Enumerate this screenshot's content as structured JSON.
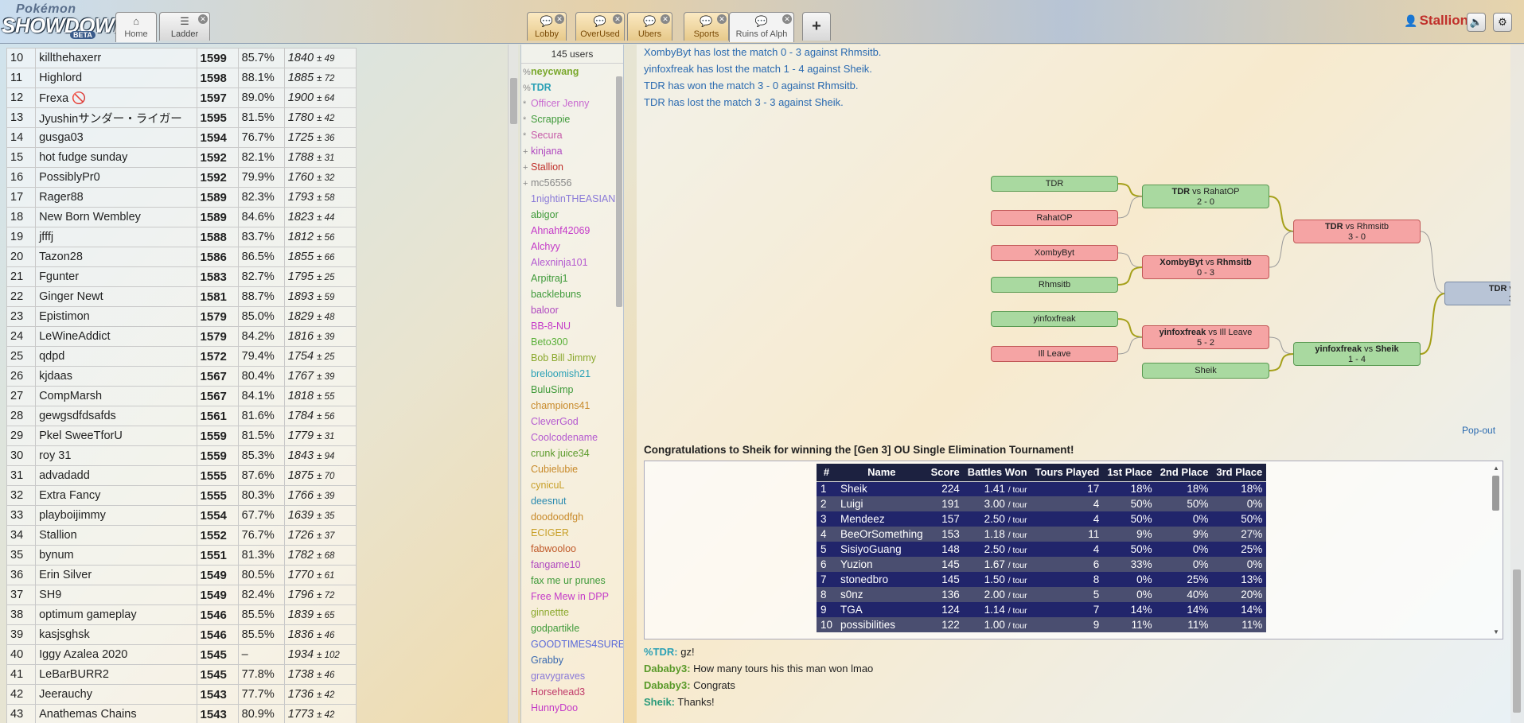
{
  "header": {
    "logo_top": "Pokémon",
    "logo_main": "SHOWDOWN!",
    "logo_badge": "BETA",
    "tabs_left": [
      {
        "label": "Home",
        "icon": "⌂",
        "closable": false
      },
      {
        "label": "Ladder",
        "icon": "☰",
        "closable": true
      }
    ],
    "tabs_rooms": [
      {
        "label": "Lobby",
        "icon": "💬"
      },
      {
        "label": "OverUsed",
        "icon": "💬"
      },
      {
        "label": "Ubers",
        "icon": "💬"
      },
      {
        "label": "Sports",
        "icon": "💬"
      },
      {
        "label": "Ruins of Alph",
        "icon": "💬"
      }
    ],
    "tab_plus": "+",
    "username": "Stallion",
    "user_icon": "👤",
    "sound_icon": "🔈",
    "settings_icon": "⚙"
  },
  "ladder": {
    "rows": [
      {
        "rank": "10",
        "name": "killthehaxerr",
        "elo": "1599",
        "gxe": "85.7%",
        "glicko": "1840",
        "dev": "± 49"
      },
      {
        "rank": "11",
        "name": "Highlord",
        "elo": "1598",
        "gxe": "88.1%",
        "glicko": "1885",
        "dev": "± 72"
      },
      {
        "rank": "12",
        "name": "Frexa 🚫",
        "elo": "1597",
        "gxe": "89.0%",
        "glicko": "1900",
        "dev": "± 64"
      },
      {
        "rank": "13",
        "name": "Jyushinサンダー・ライガー",
        "elo": "1595",
        "gxe": "81.5%",
        "glicko": "1780",
        "dev": "± 42"
      },
      {
        "rank": "14",
        "name": "gusga03",
        "elo": "1594",
        "gxe": "76.7%",
        "glicko": "1725",
        "dev": "± 36"
      },
      {
        "rank": "15",
        "name": "hot fudge sunday",
        "elo": "1592",
        "gxe": "82.1%",
        "glicko": "1788",
        "dev": "± 31"
      },
      {
        "rank": "16",
        "name": "PossiblyPr0",
        "elo": "1592",
        "gxe": "79.9%",
        "glicko": "1760",
        "dev": "± 32"
      },
      {
        "rank": "17",
        "name": "Rager88",
        "elo": "1589",
        "gxe": "82.3%",
        "glicko": "1793",
        "dev": "± 58"
      },
      {
        "rank": "18",
        "name": "New Born Wembley",
        "elo": "1589",
        "gxe": "84.6%",
        "glicko": "1823",
        "dev": "± 44"
      },
      {
        "rank": "19",
        "name": "jfffj",
        "elo": "1588",
        "gxe": "83.7%",
        "glicko": "1812",
        "dev": "± 56"
      },
      {
        "rank": "20",
        "name": "Tazon28",
        "elo": "1586",
        "gxe": "86.5%",
        "glicko": "1855",
        "dev": "± 66"
      },
      {
        "rank": "21",
        "name": "Fgunter",
        "elo": "1583",
        "gxe": "82.7%",
        "glicko": "1795",
        "dev": "± 25"
      },
      {
        "rank": "22",
        "name": "Ginger Newt",
        "elo": "1581",
        "gxe": "88.7%",
        "glicko": "1893",
        "dev": "± 59"
      },
      {
        "rank": "23",
        "name": "Epistimon",
        "elo": "1579",
        "gxe": "85.0%",
        "glicko": "1829",
        "dev": "± 48"
      },
      {
        "rank": "24",
        "name": "LeWineAddict",
        "elo": "1579",
        "gxe": "84.2%",
        "glicko": "1816",
        "dev": "± 39"
      },
      {
        "rank": "25",
        "name": "qdpd",
        "elo": "1572",
        "gxe": "79.4%",
        "glicko": "1754",
        "dev": "± 25"
      },
      {
        "rank": "26",
        "name": "kjdaas",
        "elo": "1567",
        "gxe": "80.4%",
        "glicko": "1767",
        "dev": "± 39"
      },
      {
        "rank": "27",
        "name": "CompMarsh",
        "elo": "1567",
        "gxe": "84.1%",
        "glicko": "1818",
        "dev": "± 55"
      },
      {
        "rank": "28",
        "name": "gewgsdfdsafds",
        "elo": "1561",
        "gxe": "81.6%",
        "glicko": "1784",
        "dev": "± 56"
      },
      {
        "rank": "29",
        "name": "Pkel SweeTforU",
        "elo": "1559",
        "gxe": "81.5%",
        "glicko": "1779",
        "dev": "± 31"
      },
      {
        "rank": "30",
        "name": "roy 31",
        "elo": "1559",
        "gxe": "85.3%",
        "glicko": "1843",
        "dev": "± 94"
      },
      {
        "rank": "31",
        "name": "advadadd",
        "elo": "1555",
        "gxe": "87.6%",
        "glicko": "1875",
        "dev": "± 70"
      },
      {
        "rank": "32",
        "name": "Extra Fancy",
        "elo": "1555",
        "gxe": "80.3%",
        "glicko": "1766",
        "dev": "± 39"
      },
      {
        "rank": "33",
        "name": "playboijimmy",
        "elo": "1554",
        "gxe": "67.7%",
        "glicko": "1639",
        "dev": "± 35"
      },
      {
        "rank": "34",
        "name": "Stallion",
        "elo": "1552",
        "gxe": "76.7%",
        "glicko": "1726",
        "dev": "± 37"
      },
      {
        "rank": "35",
        "name": "bynum",
        "elo": "1551",
        "gxe": "81.3%",
        "glicko": "1782",
        "dev": "± 68"
      },
      {
        "rank": "36",
        "name": "Erin Silver",
        "elo": "1549",
        "gxe": "80.5%",
        "glicko": "1770",
        "dev": "± 61"
      },
      {
        "rank": "37",
        "name": "SH9",
        "elo": "1549",
        "gxe": "82.4%",
        "glicko": "1796",
        "dev": "± 72"
      },
      {
        "rank": "38",
        "name": "optimum gameplay",
        "elo": "1546",
        "gxe": "85.5%",
        "glicko": "1839",
        "dev": "± 65"
      },
      {
        "rank": "39",
        "name": "kasjsghsk",
        "elo": "1546",
        "gxe": "85.5%",
        "glicko": "1836",
        "dev": "± 46"
      },
      {
        "rank": "40",
        "name": "Iggy Azalea 2020",
        "elo": "1545",
        "gxe": "–",
        "glicko": "1934",
        "dev": "± 102"
      },
      {
        "rank": "41",
        "name": "LeBarBURR2",
        "elo": "1545",
        "gxe": "77.8%",
        "glicko": "1738",
        "dev": "± 46"
      },
      {
        "rank": "42",
        "name": "Jeerauchy",
        "elo": "1543",
        "gxe": "77.7%",
        "glicko": "1736",
        "dev": "± 42"
      },
      {
        "rank": "43",
        "name": "Anathemas Chains",
        "elo": "1543",
        "gxe": "80.9%",
        "glicko": "1773",
        "dev": "± 42"
      }
    ]
  },
  "userlist": {
    "count": "145 users",
    "users": [
      {
        "sym": "%",
        "name": "neycwang",
        "color": "#7aa82c",
        "bold": true
      },
      {
        "sym": "%",
        "name": "TDR",
        "color": "#2aa0b5",
        "bold": true
      },
      {
        "sym": "*",
        "name": "Officer Jenny",
        "color": "#c86ad0",
        "bold": false
      },
      {
        "sym": "*",
        "name": "Scrappie",
        "color": "#3f9a3a",
        "bold": false
      },
      {
        "sym": "*",
        "name": "Secura",
        "color": "#c55aa8",
        "bold": false
      },
      {
        "sym": "+",
        "name": "kinjana",
        "color": "#b04ac0",
        "bold": false
      },
      {
        "sym": "+",
        "name": "Stallion",
        "color": "#c0302b",
        "bold": false
      },
      {
        "sym": "+",
        "name": "mc56556",
        "color": "#888888",
        "bold": false
      },
      {
        "sym": "",
        "name": "1nightinTHEASIAN",
        "color": "#8a7ad8",
        "bold": false
      },
      {
        "sym": "",
        "name": "abigor",
        "color": "#3f9a3a",
        "bold": false
      },
      {
        "sym": "",
        "name": "Ahnahf42069",
        "color": "#c43ac8",
        "bold": false
      },
      {
        "sym": "",
        "name": "Alchyy",
        "color": "#c43ac8",
        "bold": false
      },
      {
        "sym": "",
        "name": "Alexninja101",
        "color": "#b45ad0",
        "bold": false
      },
      {
        "sym": "",
        "name": "Arpitraj1",
        "color": "#3f9a3a",
        "bold": false
      },
      {
        "sym": "",
        "name": "backlebuns",
        "color": "#3f9a3a",
        "bold": false
      },
      {
        "sym": "",
        "name": "baloor",
        "color": "#b04ac0",
        "bold": false
      },
      {
        "sym": "",
        "name": "BB-8-NU",
        "color": "#c43ac8",
        "bold": false
      },
      {
        "sym": "",
        "name": "Beto300",
        "color": "#5ab03a",
        "bold": false
      },
      {
        "sym": "",
        "name": "Bob Bill Jimmy",
        "color": "#8aa82c",
        "bold": false
      },
      {
        "sym": "",
        "name": "breloomish21",
        "color": "#2aa0b5",
        "bold": false
      },
      {
        "sym": "",
        "name": "BuluSimp",
        "color": "#3f9a3a",
        "bold": false
      },
      {
        "sym": "",
        "name": "champions41",
        "color": "#c88a2a",
        "bold": false
      },
      {
        "sym": "",
        "name": "CleverGod",
        "color": "#b45ad0",
        "bold": false
      },
      {
        "sym": "",
        "name": "Coolcodename",
        "color": "#b45ad0",
        "bold": false
      },
      {
        "sym": "",
        "name": "crunk juice34",
        "color": "#5a9a2a",
        "bold": false
      },
      {
        "sym": "",
        "name": "Cubielubie",
        "color": "#c88a2a",
        "bold": false
      },
      {
        "sym": "",
        "name": "cynicuL",
        "color": "#c8a02a",
        "bold": false
      },
      {
        "sym": "",
        "name": "deesnut",
        "color": "#2a8ab0",
        "bold": false
      },
      {
        "sym": "",
        "name": "doodoodfgh",
        "color": "#c88a2a",
        "bold": false
      },
      {
        "sym": "",
        "name": "ECIGER",
        "color": "#c8a02a",
        "bold": false
      },
      {
        "sym": "",
        "name": "fabwooloo",
        "color": "#c05a2a",
        "bold": false
      },
      {
        "sym": "",
        "name": "fangame10",
        "color": "#b04ac0",
        "bold": false
      },
      {
        "sym": "",
        "name": "fax me ur prunes",
        "color": "#3f9a3a",
        "bold": false
      },
      {
        "sym": "",
        "name": "Free Mew in DPP",
        "color": "#c43ac8",
        "bold": false
      },
      {
        "sym": "",
        "name": "ginnettte",
        "color": "#8aa82c",
        "bold": false
      },
      {
        "sym": "",
        "name": "godpartikle",
        "color": "#3f9a3a",
        "bold": false
      },
      {
        "sym": "",
        "name": "GOODTIMES4SURE",
        "color": "#5a6ad8",
        "bold": false
      },
      {
        "sym": "",
        "name": "Grabby",
        "color": "#3a6ab0",
        "bold": false
      },
      {
        "sym": "",
        "name": "gravygraves",
        "color": "#8a7ad8",
        "bold": false
      },
      {
        "sym": "",
        "name": "Horsehead3",
        "color": "#c03a6a",
        "bold": false
      },
      {
        "sym": "",
        "name": "HunnyDoo",
        "color": "#c43ac8",
        "bold": false
      }
    ]
  },
  "chat": {
    "lines": [
      "XombyByt has lost the match 0 - 3 against Rhmsitb.",
      "yinfoxfreak has lost the match 1 - 4 against Sheik.",
      "TDR has won the match 3 - 0 against Rhmsitb.",
      "TDR has lost the match 3 - 3 against Sheik."
    ],
    "popout": "Pop-out",
    "congrats": "Congratulations to Sheik for winning the [Gen 3] OU Single Elimination Tournament!",
    "messages": [
      {
        "user": "%TDR:",
        "text": " gz!",
        "color": "#2aa0b5"
      },
      {
        "user": "Dababy3:",
        "text": " How many tours his this man won lmao",
        "color": "#5a9a2a"
      },
      {
        "user": "Dababy3:",
        "text": " Congrats",
        "color": "#5a9a2a"
      },
      {
        "user": "Sheik:",
        "text": " Thanks!",
        "color": "#2a9a7a"
      }
    ]
  },
  "bracket": {
    "round1": [
      {
        "name": "TDR",
        "color": "green"
      },
      {
        "name": "RahatOP",
        "color": "red"
      },
      {
        "name": "XombyByt",
        "color": "red"
      },
      {
        "name": "Rhmsitb",
        "color": "green"
      },
      {
        "name": "yinfoxfreak",
        "color": "green"
      },
      {
        "name": "Ill Leave",
        "color": "red"
      },
      {
        "name": "Sheik",
        "color": "green"
      }
    ],
    "round2": [
      {
        "a": "TDR",
        "vs": " vs ",
        "b": "RahatOP",
        "winner": "a",
        "score": "2 - 0",
        "color": "green"
      },
      {
        "a": "XombyByt",
        "vs": " vs ",
        "b": "Rhmsitb",
        "winner": "both",
        "score": "0 - 3",
        "color": "red"
      },
      {
        "a": "yinfoxfreak",
        "vs": " vs ",
        "b": "Ill Leave",
        "winner": "a",
        "score": "5 - 2",
        "color": "red"
      },
      {
        "a": "yinfoxfreak",
        "vs": " vs ",
        "b": "Sheik",
        "winner": "both",
        "score": "1 - 4",
        "color": "green"
      }
    ],
    "round3": [
      {
        "a": "TDR",
        "vs": " vs ",
        "b": "Rhmsitb",
        "winner": "a",
        "score": "3 - 0",
        "color": "red"
      },
      {
        "a": "TDR",
        "vs": " v",
        "b": "",
        "winner": "a",
        "score": "3",
        "color": "gray"
      }
    ]
  },
  "results": {
    "headers": [
      "#",
      "Name",
      "Score",
      "Battles Won",
      "Tours Played",
      "1st Place",
      "2nd Place",
      "3rd Place"
    ],
    "per_tour": "/ tour",
    "rows": [
      {
        "n": "1",
        "name": "Sheik",
        "score": "224",
        "bw": "1.41",
        "tp": "17",
        "p1": "18%",
        "p2": "18%",
        "p3": "18%"
      },
      {
        "n": "2",
        "name": "Luigi",
        "score": "191",
        "bw": "3.00",
        "tp": "4",
        "p1": "50%",
        "p2": "50%",
        "p3": "0%"
      },
      {
        "n": "3",
        "name": "Mendeez",
        "score": "157",
        "bw": "2.50",
        "tp": "4",
        "p1": "50%",
        "p2": "0%",
        "p3": "50%"
      },
      {
        "n": "4",
        "name": "BeeOrSomething",
        "score": "153",
        "bw": "1.18",
        "tp": "11",
        "p1": "9%",
        "p2": "9%",
        "p3": "27%"
      },
      {
        "n": "5",
        "name": "SisiyoGuang",
        "score": "148",
        "bw": "2.50",
        "tp": "4",
        "p1": "50%",
        "p2": "0%",
        "p3": "25%"
      },
      {
        "n": "6",
        "name": "Yuzion",
        "score": "145",
        "bw": "1.67",
        "tp": "6",
        "p1": "33%",
        "p2": "0%",
        "p3": "0%"
      },
      {
        "n": "7",
        "name": "stonedbro",
        "score": "145",
        "bw": "1.50",
        "tp": "8",
        "p1": "0%",
        "p2": "25%",
        "p3": "13%"
      },
      {
        "n": "8",
        "name": "s0nz",
        "score": "136",
        "bw": "2.00",
        "tp": "5",
        "p1": "0%",
        "p2": "40%",
        "p3": "20%"
      },
      {
        "n": "9",
        "name": "TGA",
        "score": "124",
        "bw": "1.14",
        "tp": "7",
        "p1": "14%",
        "p2": "14%",
        "p3": "14%"
      },
      {
        "n": "10",
        "name": "possibilities",
        "score": "122",
        "bw": "1.00",
        "tp": "9",
        "p1": "11%",
        "p2": "11%",
        "p3": "11%"
      }
    ]
  }
}
